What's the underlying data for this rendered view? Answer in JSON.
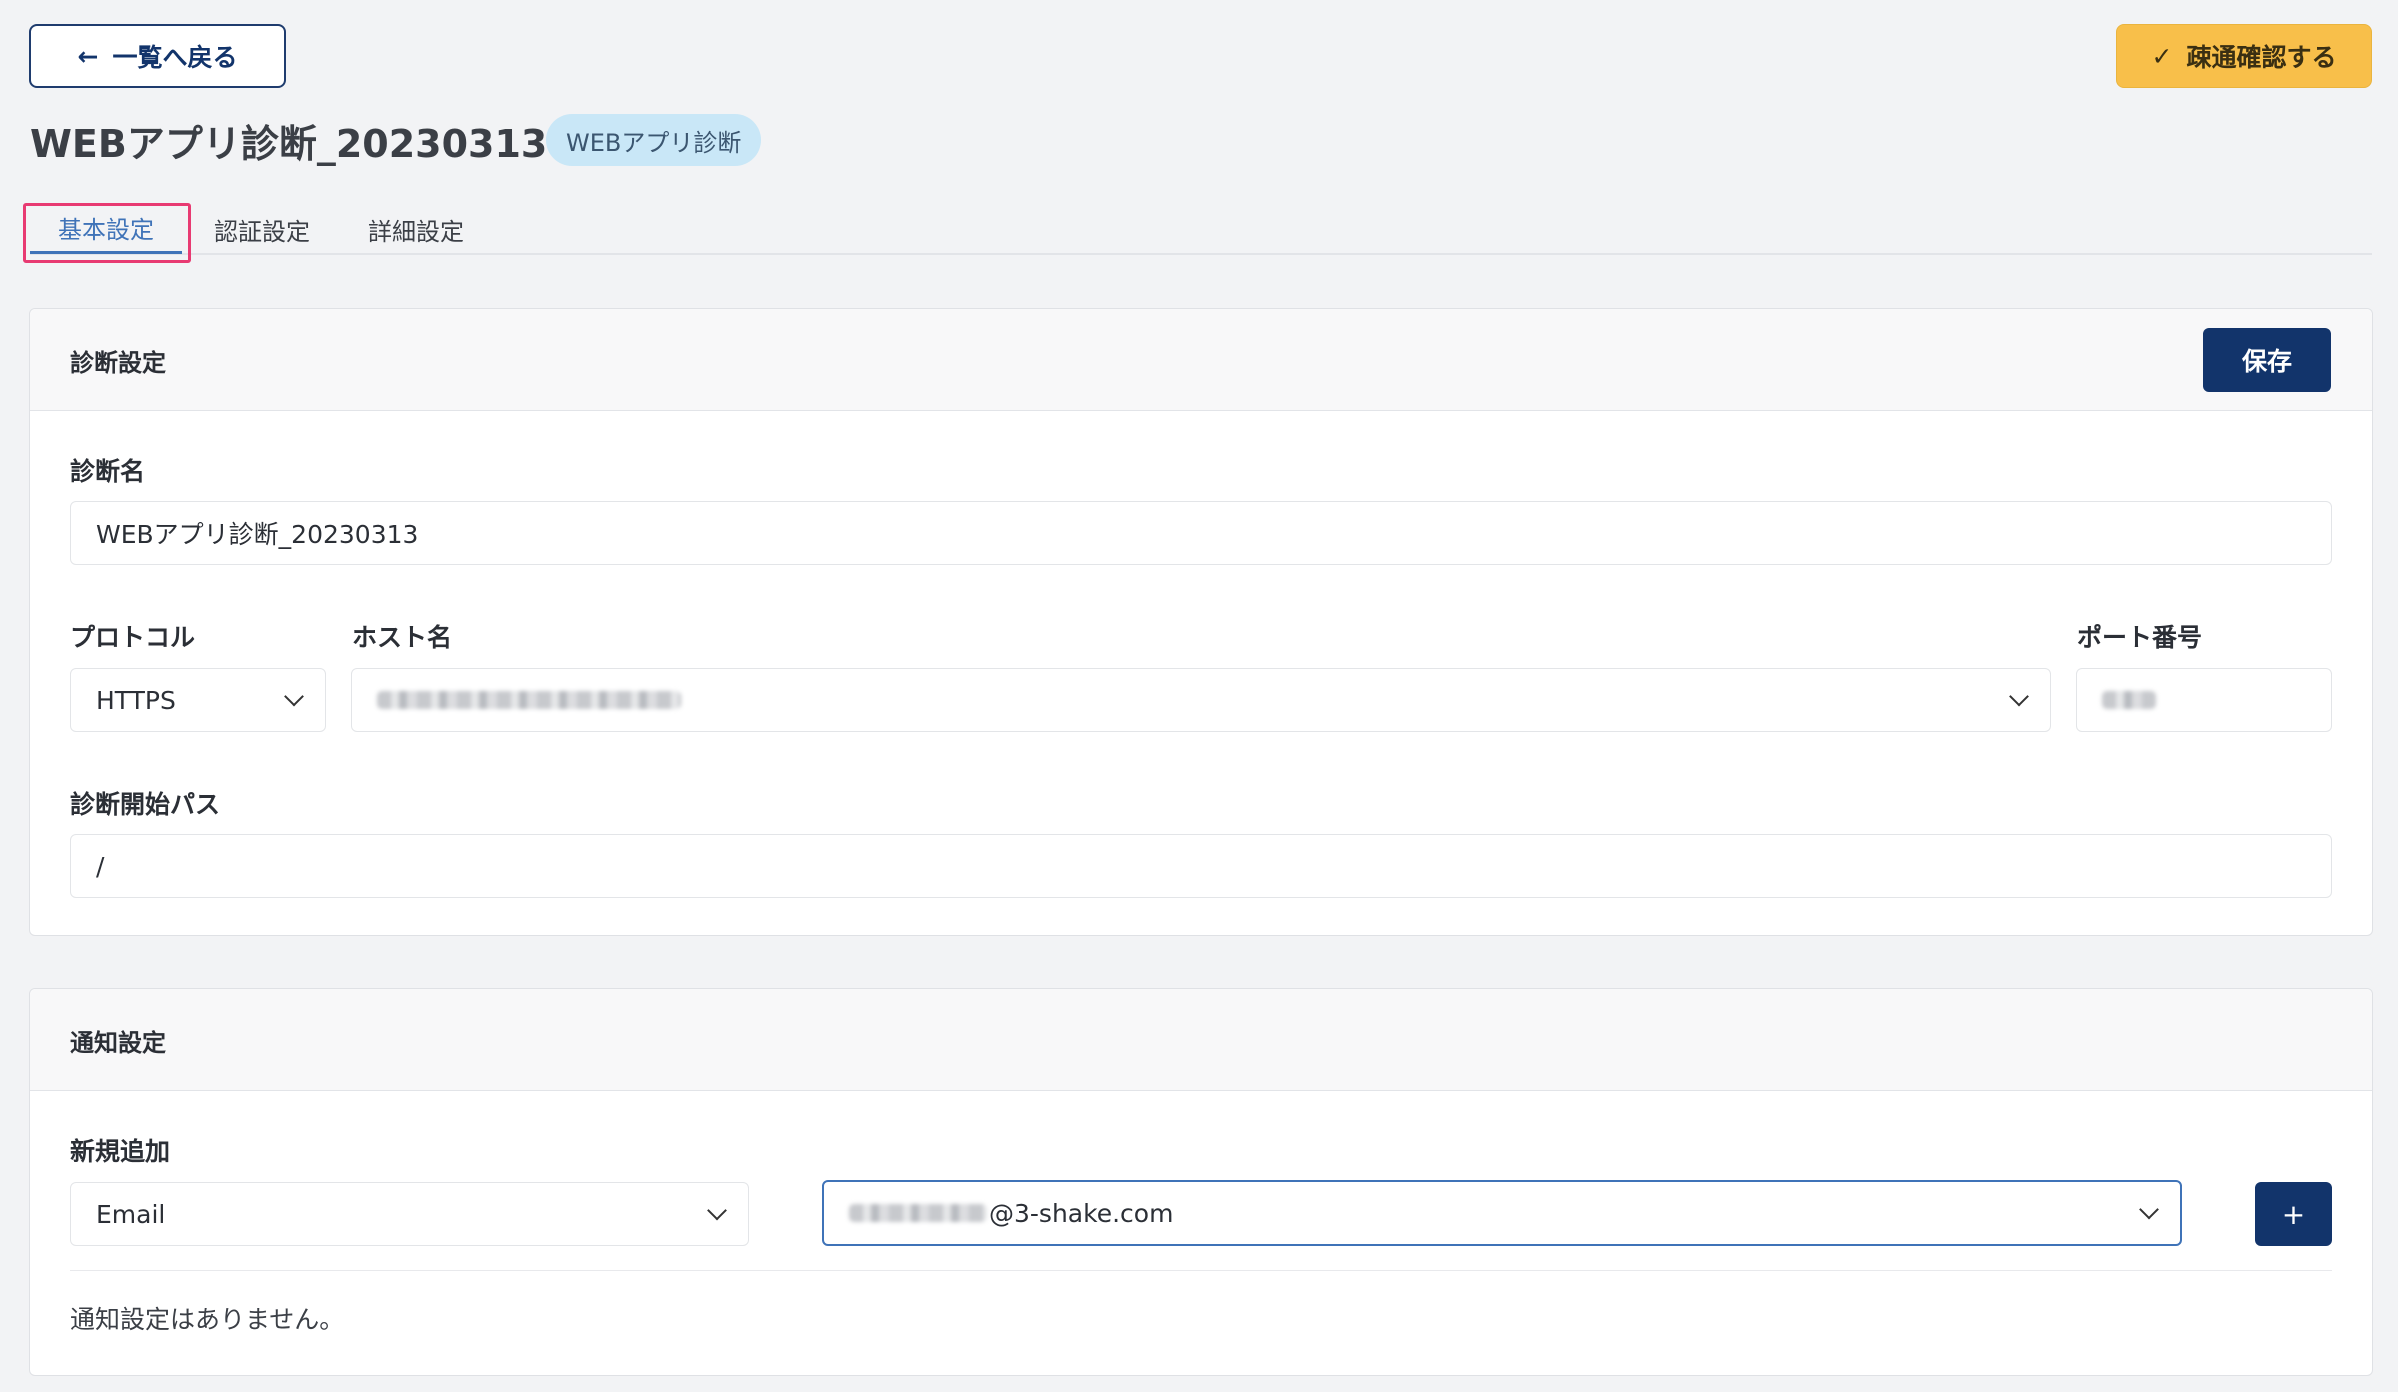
{
  "header": {
    "back_label": "一覧へ戻る",
    "back_arrow": "←",
    "check_icon_glyph": "✓",
    "check_label": "疎通確認する",
    "title": "WEBアプリ診断_20230313",
    "badge": "WEBアプリ診断"
  },
  "tabs": [
    {
      "label": "基本設定",
      "active": true
    },
    {
      "label": "認証設定",
      "active": false
    },
    {
      "label": "詳細設定",
      "active": false
    }
  ],
  "diagnosis": {
    "section_title": "診断設定",
    "save_label": "保存",
    "name_label": "診断名",
    "name_value": "WEBアプリ診断_20230313",
    "protocol_label": "プロトコル",
    "protocol_value": "HTTPS",
    "host_label": "ホスト名",
    "port_label": "ポート番号",
    "path_label": "診断開始パス",
    "path_value": "/"
  },
  "notification": {
    "section_title": "通知設定",
    "new_label": "新規追加",
    "type_value": "Email",
    "email_suffix": "@3-shake.com",
    "add_glyph": "+",
    "empty_message": "通知設定はありません。"
  },
  "colors": {
    "primary": "#12346b",
    "accent_button": "#f8bf4a",
    "active_tab": "#3f73b8",
    "highlight": "#e83a72",
    "badge_bg": "#c9e7f7"
  }
}
